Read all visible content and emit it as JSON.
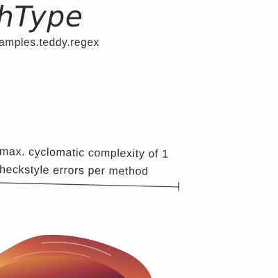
{
  "header": {
    "title": "hType",
    "subtitle": "amples.teddy.regex"
  },
  "annotation": {
    "line1": "max. cyclomatic complexity of 1",
    "line2": "heckstyle errors per method"
  },
  "colors": {
    "text": "#2c2c2c",
    "background": "#fdfdfd",
    "blob_dark": "#6e1b3e",
    "blob_mid": "#b4413a",
    "blob_light": "#e8a04a"
  }
}
